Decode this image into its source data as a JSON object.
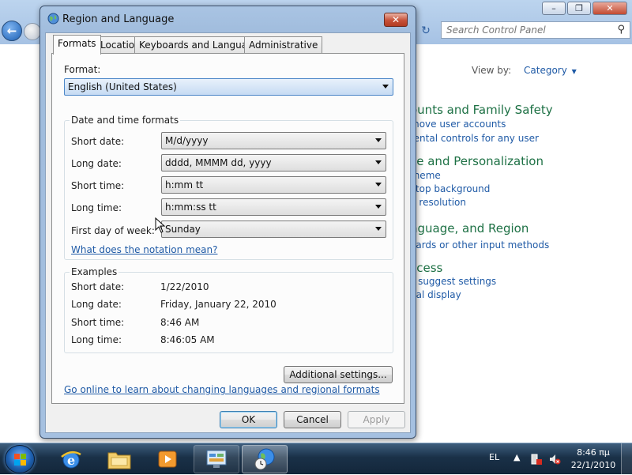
{
  "control_panel": {
    "search_placeholder": "Search Control Panel",
    "view_by_label": "View by:",
    "view_by_value": "Category",
    "categories": [
      {
        "title": "ounts and Family Safety",
        "links": [
          "move user accounts",
          "rental controls for any user"
        ]
      },
      {
        "title": "ce and Personalization",
        "links": [
          "theme",
          "ktop background",
          "n resolution"
        ]
      },
      {
        "title": "nguage, and Region",
        "links": [
          "oards or other input methods"
        ]
      },
      {
        "title": "ccess",
        "links": [
          "s suggest settings",
          "ual display"
        ]
      }
    ]
  },
  "dialog": {
    "title": "Region and Language",
    "tabs": [
      "Formats",
      "Location",
      "Keyboards and Languages",
      "Administrative"
    ],
    "format_label": "Format:",
    "format_value": "English (United States)",
    "date_time_group": "Date and time formats",
    "fields": [
      {
        "label": "Short date:",
        "value": "M/d/yyyy"
      },
      {
        "label": "Long date:",
        "value": "dddd, MMMM dd, yyyy"
      },
      {
        "label": "Short time:",
        "value": "h:mm tt"
      },
      {
        "label": "Long time:",
        "value": "h:mm:ss tt"
      },
      {
        "label": "First day of week:",
        "value": "Sunday"
      }
    ],
    "notation_link": "What does the notation mean?",
    "examples_group": "Examples",
    "examples": [
      {
        "label": "Short date:",
        "value": "1/22/2010"
      },
      {
        "label": "Long date:",
        "value": "Friday, January 22, 2010"
      },
      {
        "label": "Short time:",
        "value": "8:46 AM"
      },
      {
        "label": "Long time:",
        "value": "8:46:05 AM"
      }
    ],
    "additional_settings": "Additional settings...",
    "online_link": "Go online to learn about changing languages and regional formats",
    "ok": "OK",
    "cancel": "Cancel",
    "apply": "Apply"
  },
  "taskbar": {
    "language": "EL",
    "time": "8:46 πμ",
    "date": "22/1/2010"
  },
  "colors": {
    "link": "#1f5aa6",
    "category_title": "#1e7145",
    "taskbar": "#1a3148"
  }
}
